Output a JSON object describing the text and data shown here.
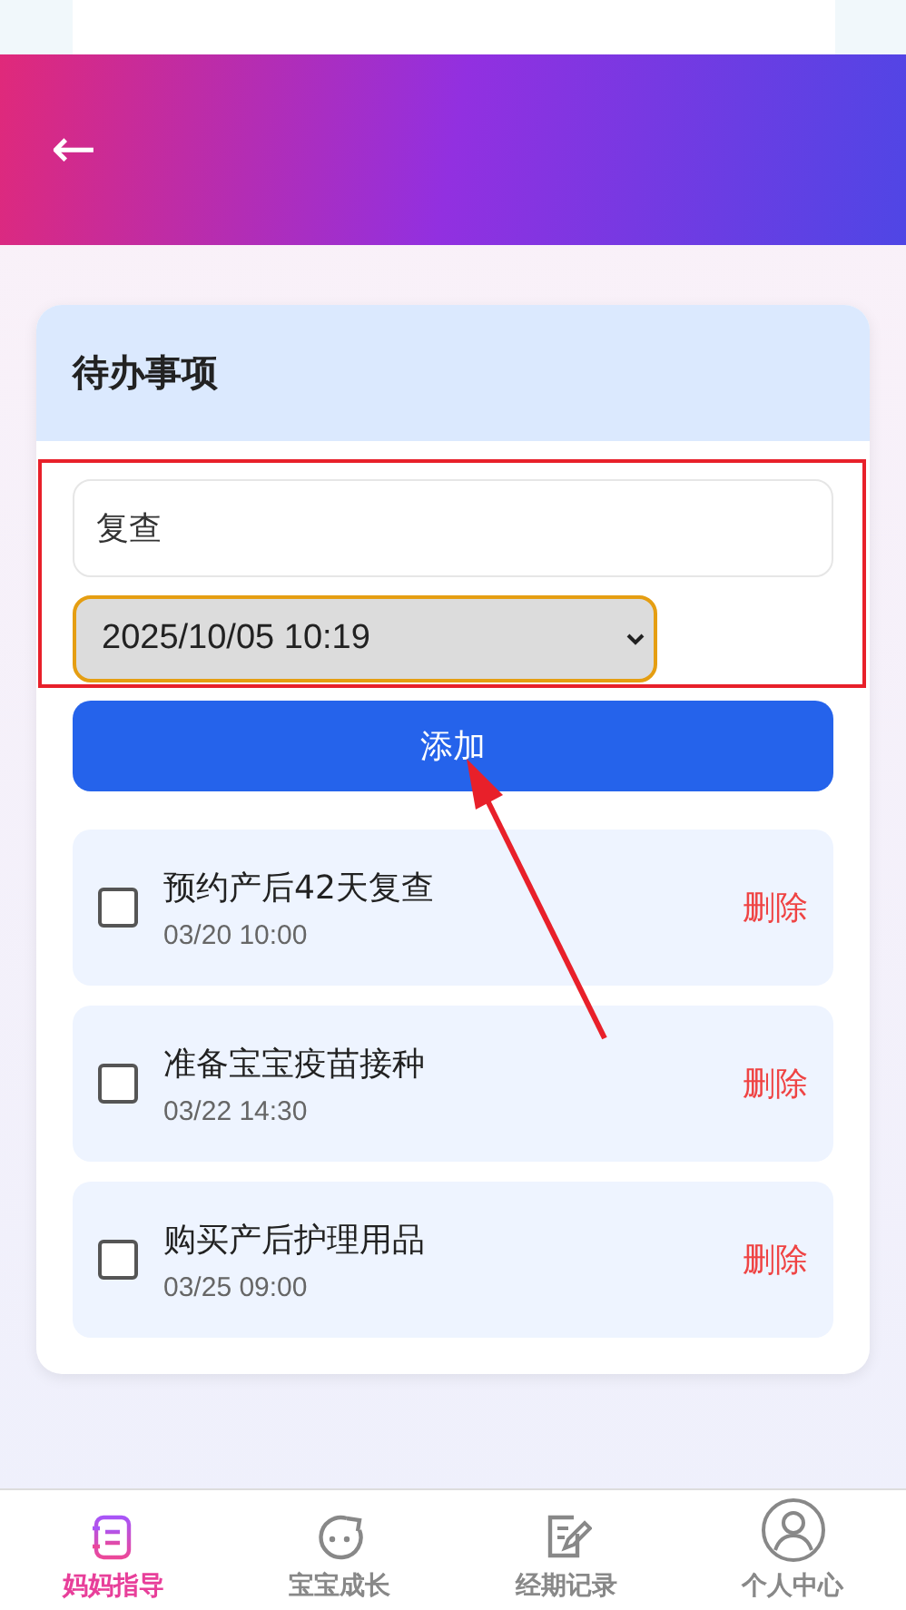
{
  "header": {
    "back": "←"
  },
  "card": {
    "title": "待办事项",
    "input": {
      "value": "复查"
    },
    "datetime": {
      "value": "2025/10/05 10:19"
    },
    "add_button": "添加",
    "todos": [
      {
        "title": "预约产后42天复查",
        "time": "03/20 10:00",
        "checked": false,
        "delete": "删除"
      },
      {
        "title": "准备宝宝疫苗接种",
        "time": "03/22 14:30",
        "checked": false,
        "delete": "删除"
      },
      {
        "title": "购买产后护理用品",
        "time": "03/25 09:00",
        "checked": false,
        "delete": "删除"
      }
    ]
  },
  "bottom_nav": [
    {
      "label": "妈妈指导",
      "kind": "notebook",
      "selected": true
    },
    {
      "label": "宝宝成长",
      "kind": "face",
      "selected": false
    },
    {
      "label": "经期记录",
      "kind": "edit",
      "selected": false
    },
    {
      "label": "个人中心",
      "kind": "person",
      "selected": false
    }
  ]
}
